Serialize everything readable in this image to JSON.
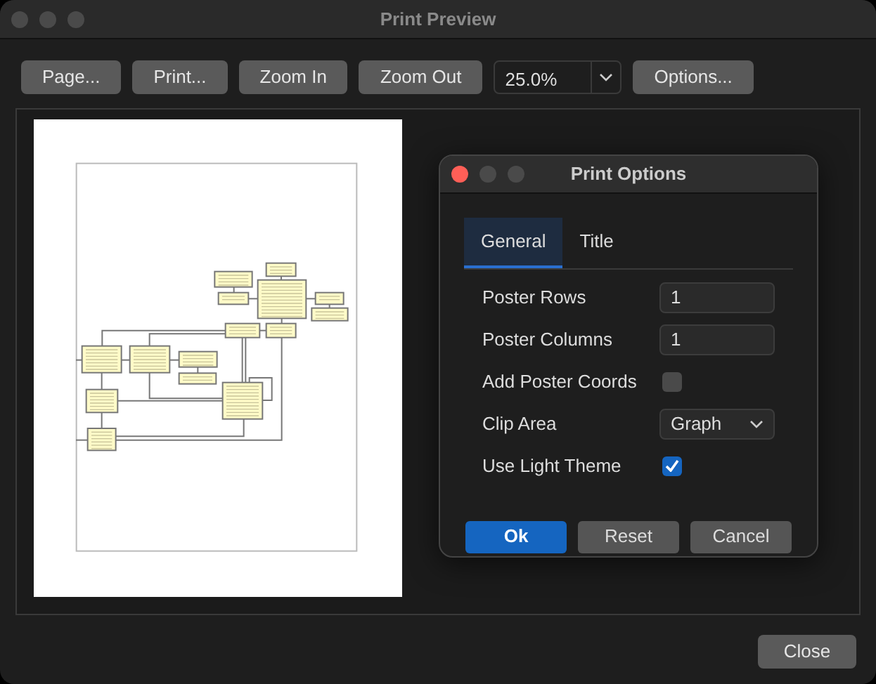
{
  "window": {
    "title": "Print Preview"
  },
  "toolbar": [
    {
      "kind": "button",
      "label": "Page..."
    },
    {
      "kind": "button",
      "label": "Print..."
    },
    {
      "kind": "button",
      "label": "Zoom In"
    },
    {
      "kind": "button",
      "label": "Zoom Out"
    },
    {
      "kind": "combo",
      "value": "25.0%"
    },
    {
      "kind": "button",
      "label": "Options..."
    }
  ],
  "dialog": {
    "title": "Print Options",
    "tabs": [
      {
        "label": "General",
        "selected": true
      },
      {
        "label": "Title",
        "selected": false
      }
    ],
    "fields": [
      {
        "kind": "text",
        "label": "Poster Rows",
        "value": "1"
      },
      {
        "kind": "text",
        "label": "Poster Columns",
        "value": "1"
      },
      {
        "kind": "checkbox",
        "label": "Add Poster Coords",
        "checked": false
      },
      {
        "kind": "select",
        "label": "Clip Area",
        "value": "Graph"
      },
      {
        "kind": "checkbox",
        "label": "Use Light Theme",
        "checked": true
      }
    ],
    "buttons": [
      {
        "label": "Ok",
        "primary": true
      },
      {
        "label": "Reset",
        "primary": false
      },
      {
        "label": "Cancel",
        "primary": false
      }
    ]
  },
  "footer_buttons": [
    "Close"
  ]
}
